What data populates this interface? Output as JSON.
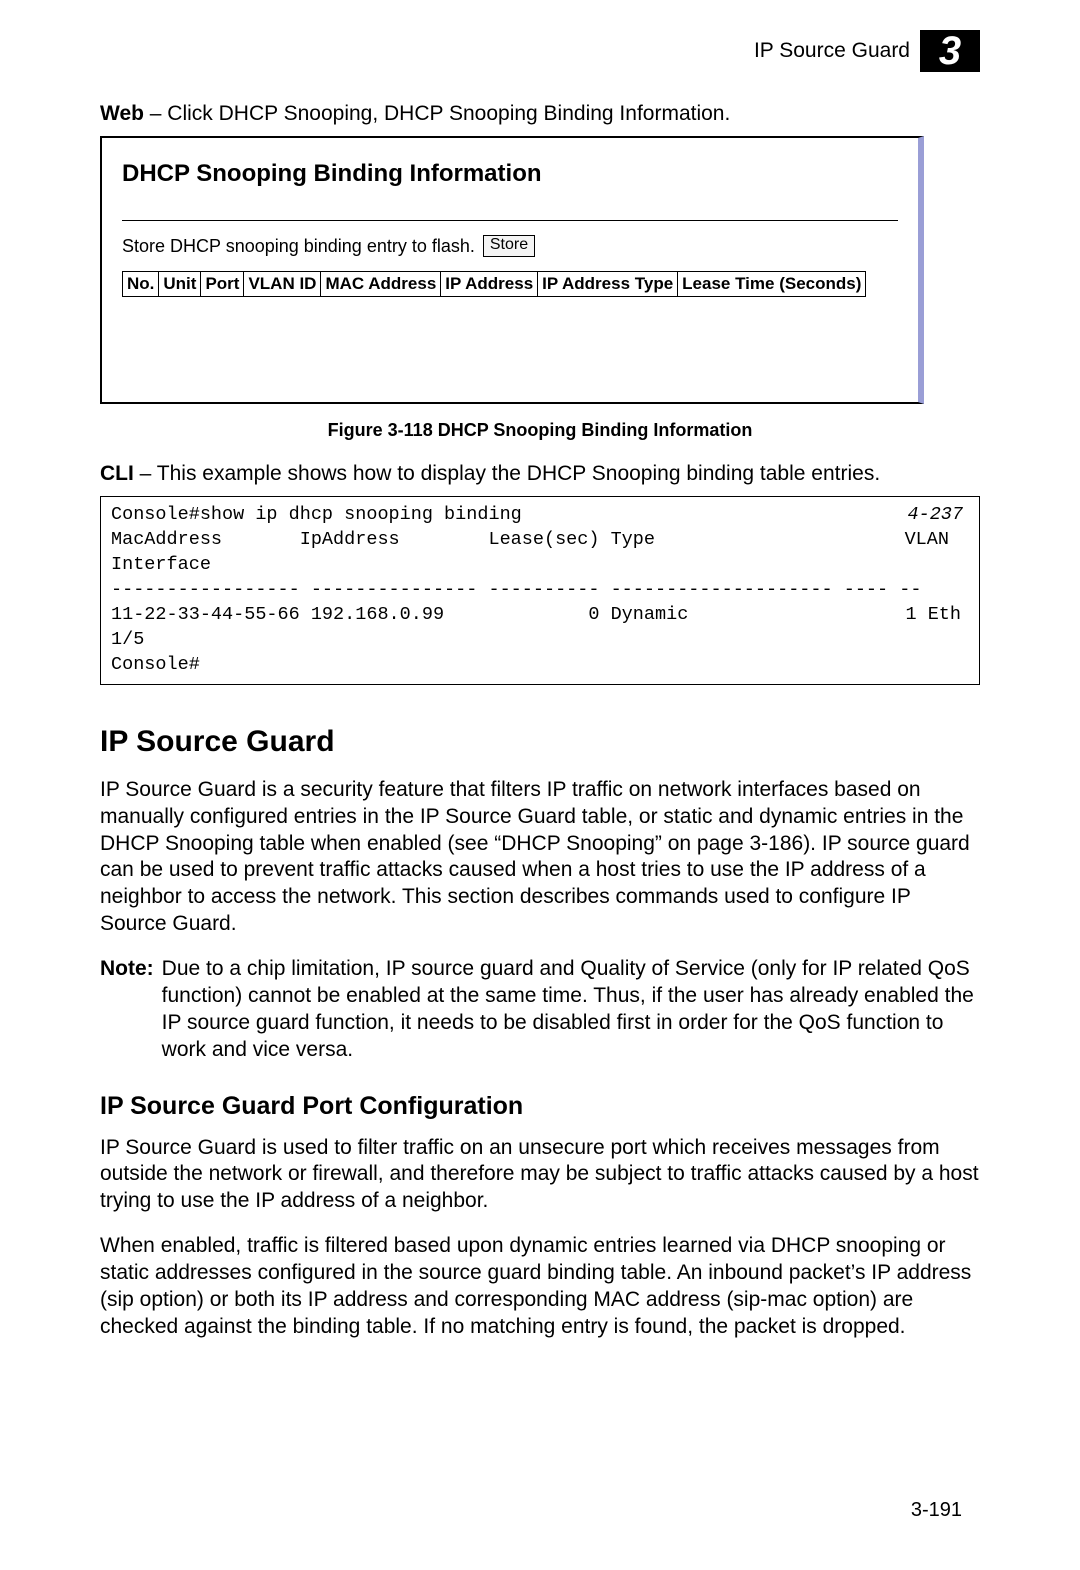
{
  "header": {
    "title": "IP Source Guard",
    "chapter_num": "3"
  },
  "web": {
    "label": "Web",
    "text": " – Click DHCP Snooping, DHCP Snooping Binding Information."
  },
  "figure": {
    "panel_title": "DHCP Snooping Binding Information",
    "store_text": "Store DHCP snooping binding entry to flash.",
    "store_button": "Store",
    "columns": [
      "No.",
      "Unit",
      "Port",
      "VLAN ID",
      "MAC Address",
      "IP Address",
      "IP Address Type",
      "Lease Time (Seconds)"
    ],
    "caption": "Figure 3-118  DHCP Snooping Binding Information"
  },
  "cli": {
    "label": "CLI",
    "text": " – This example shows how to display the DHCP Snooping binding table entries."
  },
  "console": {
    "ref": "4-237",
    "line1": "Console#show ip dhcp snooping binding",
    "line2": "MacAddress       IpAddress        Lease(sec) Type",
    "vlan": "VLAN",
    "line3": "Interface",
    "line4": "----------------- --------------- ---------- -------------------- ---- --",
    "line5": "11-22-33-44-55-66 192.168.0.99             0 Dynamic",
    "eth": "1 Eth",
    "line6": "1/5",
    "line7": "Console#"
  },
  "section": {
    "title": "IP Source Guard",
    "para1": "IP Source Guard is a security feature that filters IP traffic on network interfaces based on manually configured entries in the IP Source Guard table, or static and dynamic entries in the DHCP Snooping table when enabled (see “DHCP Snooping” on page 3-186). IP source guard can be used to prevent traffic attacks caused when a host tries to use the IP address of a neighbor to access the network. This section describes commands used to configure IP Source Guard.",
    "note_label": "Note:",
    "note_text": "Due to a chip limitation, IP source guard and Quality of Service (only for IP related QoS function) cannot be enabled at the same time. Thus, if the user has already enabled the IP source guard function, it needs to be disabled first in order for the QoS function to work and vice versa."
  },
  "subsection": {
    "title": "IP Source Guard Port Configuration",
    "para1": "IP Source Guard is used to filter traffic on an unsecure port which receives messages from outside the network or firewall, and therefore may be subject to traffic attacks caused by a host trying to use the IP address of a neighbor.",
    "para2": "When enabled, traffic is filtered based upon dynamic entries learned via DHCP snooping or static addresses configured in the source guard binding table. An inbound packet’s IP address (sip option) or both its IP address and corresponding MAC address (sip-mac option) are checked against the binding table. If no matching entry is found, the packet is dropped."
  },
  "page_number": "3-191"
}
